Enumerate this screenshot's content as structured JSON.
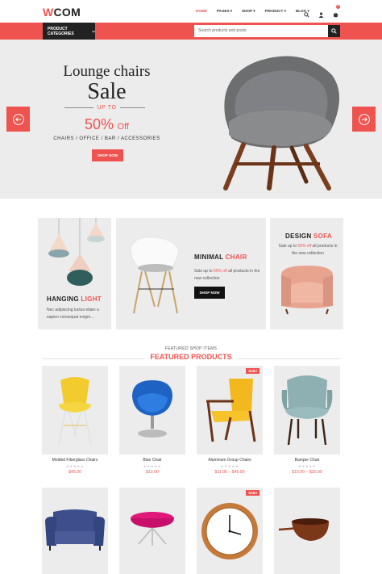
{
  "header": {
    "logo_w": "W",
    "logo_rest": "COM",
    "nav": [
      "HOME",
      "PAGES ▾",
      "SHOP ▾",
      "PRODUCT ▾",
      "BLOG ▾"
    ],
    "icons": [
      "search-icon",
      "user-icon",
      "cart-icon"
    ],
    "cart_count": "0"
  },
  "toolbar": {
    "categories_label": "PRODUCT CATEGORIES",
    "search_placeholder": "Search products and posts"
  },
  "hero": {
    "title": "Lounge chairs",
    "sale": "Sale",
    "upto": "UP TO",
    "percent": "50%",
    "off": "Off",
    "categories": "CHAIRS / OFFICE / BAR / ACCESSORIES",
    "button": "SHOP NOW"
  },
  "banners": {
    "hanging": {
      "title_a": "HANGING",
      "title_b": "LIGHT",
      "desc": "Nec adipiscing luctus etiam a sapien consequat enigm..."
    },
    "minimal": {
      "title_a": "MINIMAL",
      "title_b": "CHAIR",
      "desc_a": "Sale up to ",
      "desc_b": "50% off",
      "desc_c": " all products in the new collection",
      "button": "SHOP NOW"
    },
    "design": {
      "title_a": "DESIGN",
      "title_b": "SOFA",
      "desc_a": "Sale up to ",
      "desc_b": "50% off",
      "desc_c": " all products in the new collection"
    }
  },
  "featured": {
    "small": "FEATURED SHOP ITEMS",
    "title": "FEATURED PRODUCTS",
    "sale_badge": "Sale!",
    "stars": "★★★★★",
    "products": [
      {
        "name": "Molded Fiberglass Chairs",
        "price": "$45.00"
      },
      {
        "name": "Blue Chair",
        "price": "$12.00"
      },
      {
        "name": "Aluminum Group Chairs",
        "price": "$11.05 – $45.00"
      },
      {
        "name": "Bumper Chair",
        "price": "$15.00 – $20.00"
      }
    ]
  },
  "colors": {
    "accent": "#ef5350",
    "dark": "#222222",
    "panel": "#ececec"
  }
}
